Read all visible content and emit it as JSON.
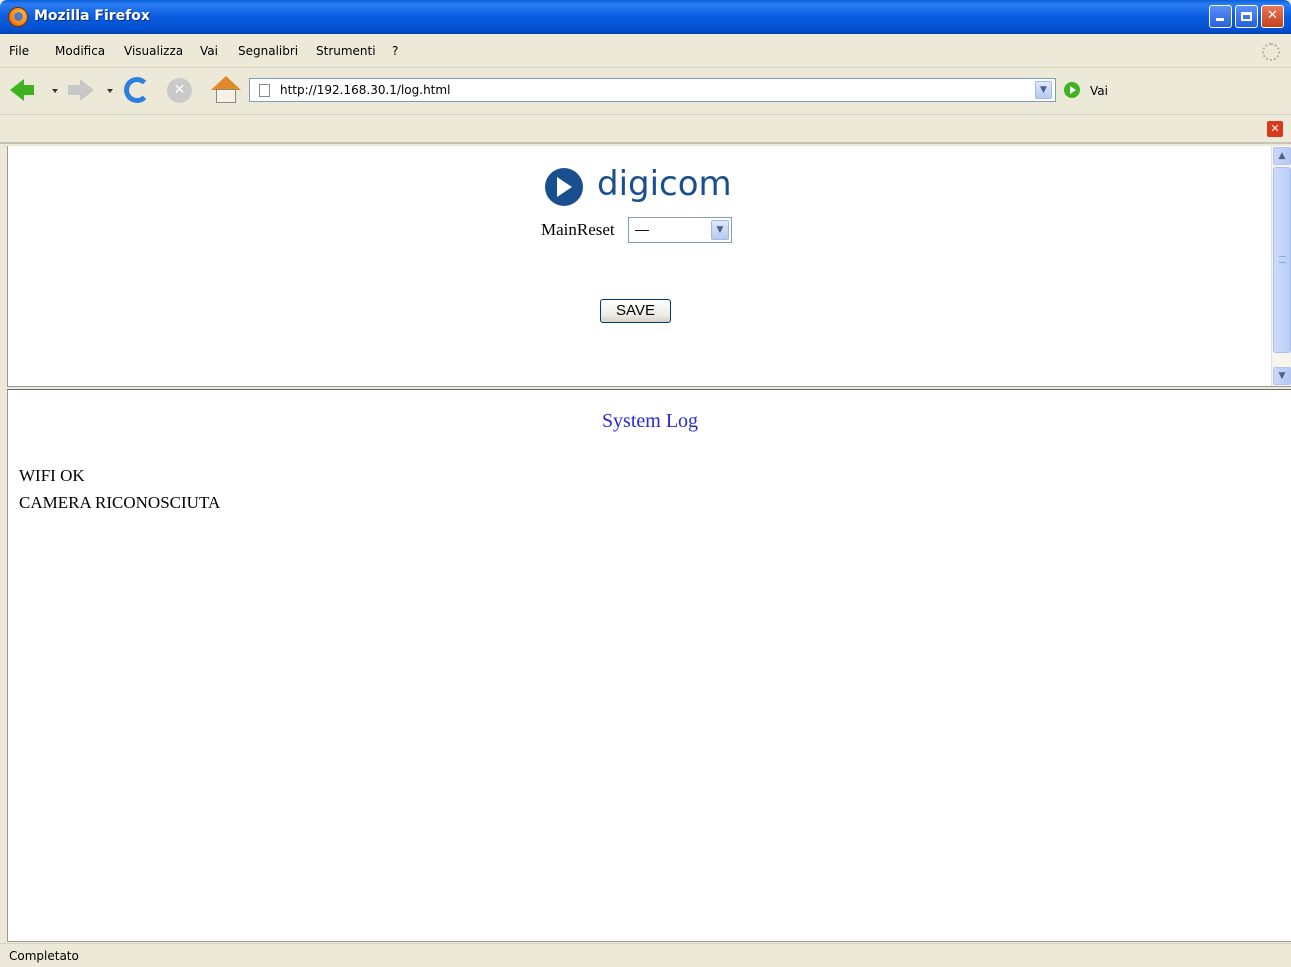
{
  "window": {
    "title": "Mozilla Firefox",
    "minimize_icon": "minimize-icon",
    "maximize_icon": "restore-icon",
    "close_icon": "close-icon"
  },
  "menubar": {
    "items": [
      {
        "label": "File"
      },
      {
        "label": "Modifica"
      },
      {
        "label": "Visualizza"
      },
      {
        "label": "Vai"
      },
      {
        "label": "Segnalibri"
      },
      {
        "label": "Strumenti"
      },
      {
        "label": "?"
      }
    ]
  },
  "navbar": {
    "url": "http://192.168.30.1/log.html",
    "go_label": "Vai"
  },
  "top_frame": {
    "logo_text": "digicom",
    "reset_label": "MainReset",
    "reset_value": "—",
    "save_label": "SAVE"
  },
  "bottom_frame": {
    "title": "System Log",
    "lines": [
      "WIFI OK",
      "CAMERA RICONOSCIUTA"
    ]
  },
  "status": {
    "text": "Completato"
  },
  "colors": {
    "titlebar": "#0b5ce0",
    "brand": "#1a4f8f",
    "log_title": "#2727e0"
  }
}
